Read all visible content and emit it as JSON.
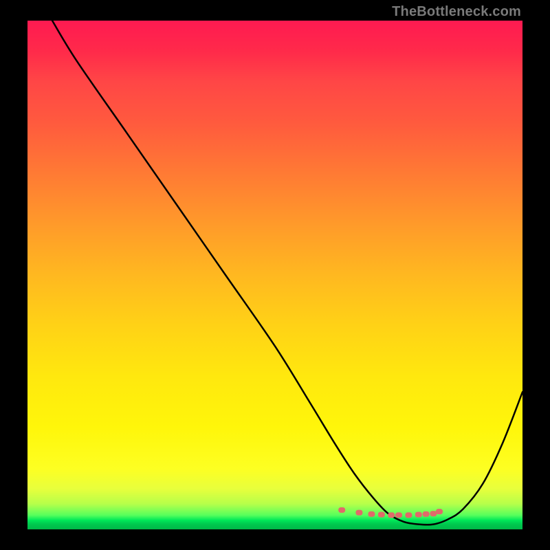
{
  "watermark": "TheBottleneck.com",
  "chart_data": {
    "type": "line",
    "title": "",
    "xlabel": "",
    "ylabel": "",
    "xlim": [
      0,
      100
    ],
    "ylim": [
      0,
      100
    ],
    "series": [
      {
        "name": "bottleneck-curve",
        "x": [
          5,
          10,
          20,
          30,
          40,
          50,
          57,
          62,
          66,
          70,
          73,
          76,
          79,
          82,
          85,
          88,
          92,
          96,
          100
        ],
        "y": [
          100,
          92,
          78,
          64,
          50,
          36,
          25,
          17,
          11,
          6,
          3,
          1.5,
          1,
          1,
          2,
          4,
          9,
          17,
          27
        ]
      }
    ],
    "markers": {
      "name": "optimal-range-dots",
      "x": [
        63.5,
        67,
        69.5,
        71.5,
        73.5,
        75,
        77,
        79,
        80.5,
        82,
        83.2
      ],
      "y": [
        3.8,
        3.3,
        3.0,
        2.9,
        2.8,
        2.8,
        2.8,
        2.9,
        3.0,
        3.1,
        3.5
      ]
    },
    "gradient_stops_pct": [
      0,
      6,
      12,
      20,
      30,
      40,
      50,
      60,
      70,
      80,
      88,
      92,
      95,
      97.2,
      98.2,
      99,
      100
    ],
    "gradient_colors": [
      "#ff1a51",
      "#ff2a4a",
      "#ff4646",
      "#ff5a3e",
      "#ff7a34",
      "#ff9a2a",
      "#ffb820",
      "#ffd216",
      "#ffe80e",
      "#fff60a",
      "#fdff22",
      "#e8ff3c",
      "#b6ff4a",
      "#58ff5c",
      "#00e858",
      "#00c84e",
      "#00b848"
    ]
  }
}
